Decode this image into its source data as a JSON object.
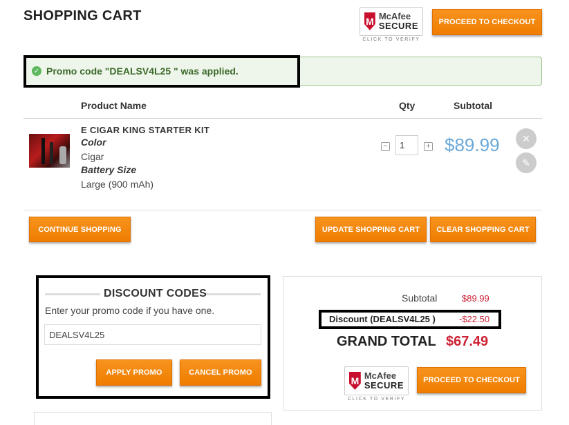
{
  "header": {
    "title": "SHOPPING CART",
    "checkout_label": "PROCEED TO CHECKOUT",
    "mcafee": {
      "brand": "McAfee",
      "secure": "SECURE",
      "verify": "CLICK TO VERIFY"
    }
  },
  "alert": {
    "message": "Promo code \"DEALSV4L25 \" was applied.",
    "icon": "check-circle-icon",
    "color": "#5cb85c"
  },
  "table": {
    "headers": {
      "product": "Product Name",
      "qty": "Qty",
      "subtotal": "Subtotal"
    },
    "items": [
      {
        "name": "E CIGAR KING STARTER KIT",
        "options": [
          {
            "label": "Color",
            "value": "Cigar"
          },
          {
            "label": "Battery Size",
            "value": "Large (900 mAh)"
          }
        ],
        "qty": "1",
        "price": "$89.99"
      }
    ]
  },
  "actions": {
    "continue_label": "CONTINUE SHOPPING",
    "update_label": "UPDATE SHOPPING CART",
    "clear_label": "CLEAR SHOPPING CART"
  },
  "discount": {
    "title": "DISCOUNT CODES",
    "hint": "Enter your promo code if you have one.",
    "code_value": "DEALSV4L25",
    "apply_label": "APPLY PROMO",
    "cancel_label": "CANCEL PROMO"
  },
  "totals": {
    "subtotal_label": "Subtotal",
    "subtotal_value": "$89.99",
    "discount_label": "Discount (DEALSV4L25 )",
    "discount_value": "-$22.50",
    "grand_label": "GRAND TOTAL",
    "grand_value": "$67.49",
    "checkout_label": "PROCEED TO CHECKOUT"
  },
  "colors": {
    "accent": "#f7931e",
    "price_blue": "#6aa8d8",
    "total_red": "#cc2233"
  }
}
